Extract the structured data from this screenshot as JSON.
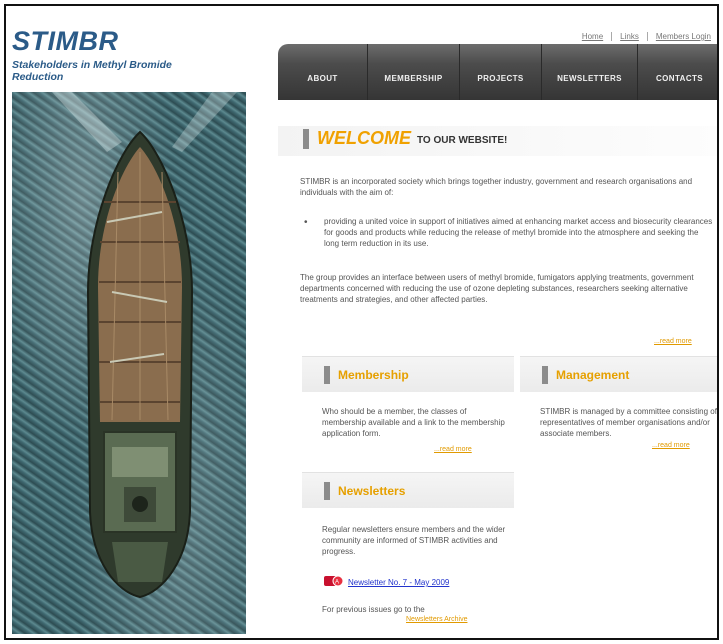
{
  "site": {
    "name": "STIMBR",
    "tagline": "Stakeholders in Methyl Bromide Reduction"
  },
  "top_links": [
    "Home",
    "Links",
    "Members Login"
  ],
  "nav": [
    "ABOUT",
    "MEMBERSHIP",
    "PROJECTS",
    "NEWSLETTERS",
    "CONTACTS"
  ],
  "welcome": {
    "big": "WELCOME",
    "small": "TO OUR WEBSITE!",
    "intro": "STIMBR is an incorporated society which brings together industry, government and research organisations and individuals with the aim of:",
    "bullet": "providing a united voice in support of initiatives aimed at enhancing market access and biosecurity clearances for goods and products while reducing the release of methyl bromide into the atmosphere and seeking the long term reduction in its use.",
    "group": "The group provides an interface between users of methyl bromide, fumigators applying treatments, government departments concerned with reducing the use of ozone depleting substances, researchers seeking alternative treatments and strategies, and other affected parties.",
    "more": "...read more"
  },
  "membership": {
    "title": "Membership",
    "body": "Who should be a member, the classes of membership available and a link to the membership application form.",
    "more": "...read more"
  },
  "management": {
    "title": "Management",
    "body": "STIMBR is managed by a committee consisting of representatives of member organisations and/or associate members.",
    "more": "...read more"
  },
  "newsletters": {
    "title": "Newsletters",
    "body": "Regular newsletters ensure members and the wider community are informed of STIMBR activities and progress.",
    "link": "Newsletter No. 7 - May 2009",
    "previous": "For previous issues go to the",
    "archive": "Newsletters Archive"
  },
  "colors": {
    "accent": "#f0a100",
    "nav_bg": "#3f3f3f",
    "brand_blue": "#2b5b88"
  }
}
